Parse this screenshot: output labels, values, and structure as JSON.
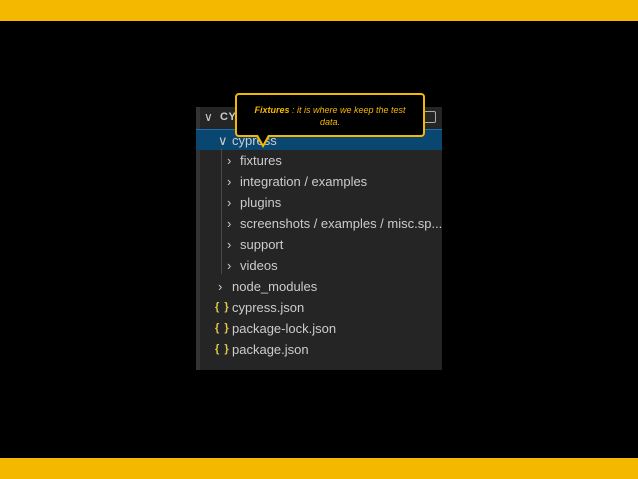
{
  "explorer": {
    "header_title": "CY",
    "items": [
      {
        "label": "cypress",
        "type": "folder",
        "expanded": true,
        "selected": true
      },
      {
        "label": "fixtures",
        "type": "folder"
      },
      {
        "label": "integration / examples",
        "type": "folder"
      },
      {
        "label": "plugins",
        "type": "folder"
      },
      {
        "label": "screenshots / examples / misc.sp...",
        "type": "folder"
      },
      {
        "label": "support",
        "type": "folder"
      },
      {
        "label": "videos",
        "type": "folder"
      },
      {
        "label": "node_modules",
        "type": "folder"
      },
      {
        "label": "cypress.json",
        "type": "json"
      },
      {
        "label": "package-lock.json",
        "type": "json"
      },
      {
        "label": "package.json",
        "type": "json"
      }
    ],
    "json_icon": "{ }"
  },
  "tooltip": {
    "term": "Fixtures",
    "text": " : it is where we keep the test data."
  },
  "colors": {
    "band": "#f5b800",
    "tooltip_border": "#f5b800",
    "selection": "#094771",
    "json_icon": "#e2c94b"
  },
  "icons": {
    "chevron_down": "chevron-down-icon",
    "chevron_right": "chevron-right-icon",
    "json": "json-braces-icon",
    "collapse": "collapse-all-icon"
  }
}
